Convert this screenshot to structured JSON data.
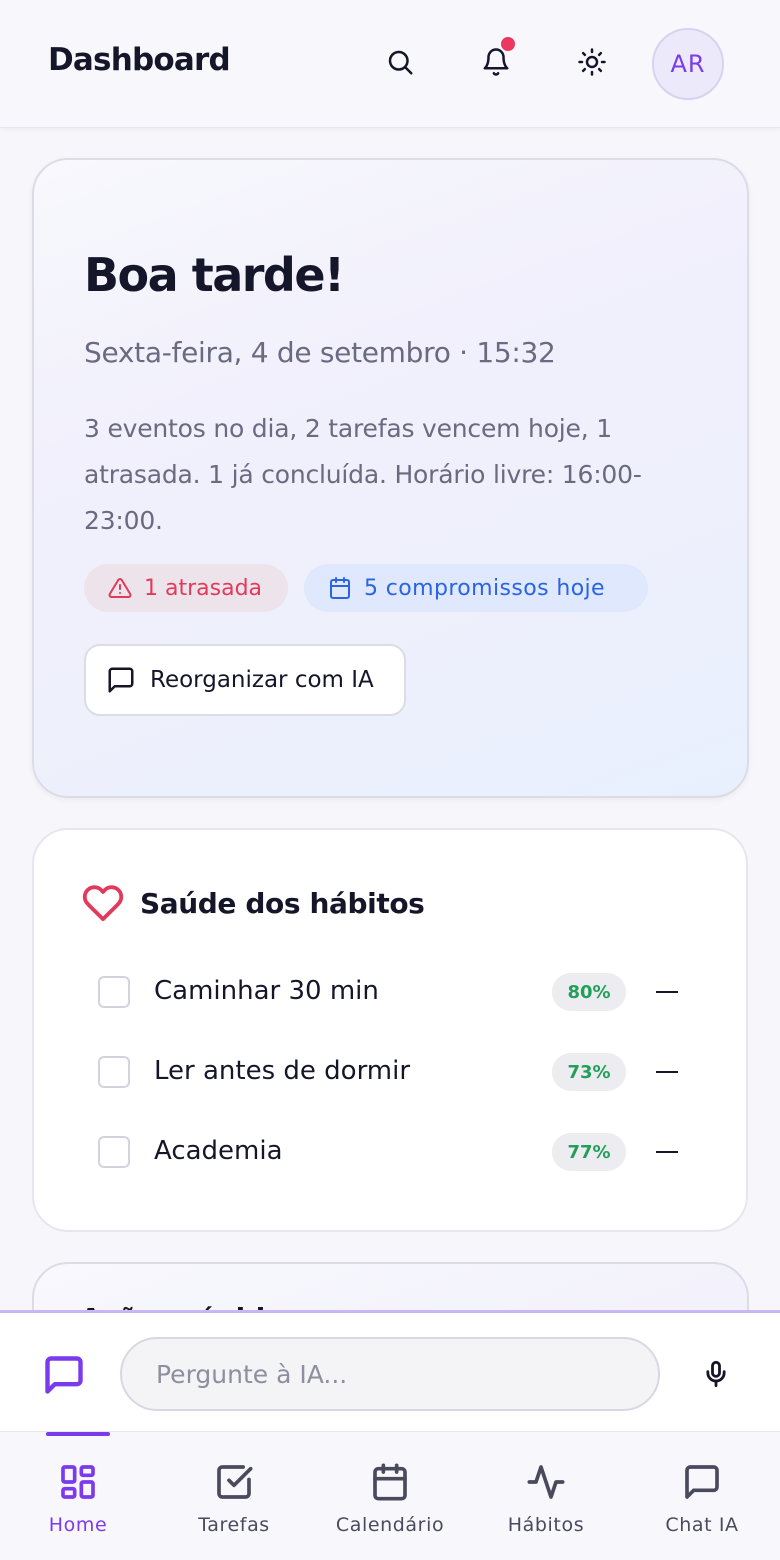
{
  "header": {
    "title": "Dashboard",
    "avatar_initials": "AR",
    "icons": [
      "search-icon",
      "bell-icon",
      "sun-icon"
    ]
  },
  "greeting": {
    "title": "Boa tarde!",
    "date": "Sexta-feira, 4 de setembro · 15:32",
    "summary": "3 eventos no dia, 2 tarefas vencem hoje, 1 atrasada. 1 já concluída. Horário livre: 16:00-23:00.",
    "chips": {
      "overdue": "1 atrasada",
      "appointments": "5 compromissos hoje"
    },
    "ai_button": "Reorganizar com IA"
  },
  "habits": {
    "title": "Saúde dos hábitos",
    "items": [
      {
        "name": "Caminhar 30 min",
        "percent": "80%"
      },
      {
        "name": "Ler antes de dormir",
        "percent": "73%"
      },
      {
        "name": "Academia",
        "percent": "77%"
      }
    ]
  },
  "partial_card": {
    "title": "Ações rápidas"
  },
  "chat": {
    "placeholder": "Pergunte à IA..."
  },
  "nav": {
    "items": [
      {
        "label": "Home",
        "icon": "grid-icon",
        "active": true
      },
      {
        "label": "Tarefas",
        "icon": "checkbox-icon",
        "active": false
      },
      {
        "label": "Calendário",
        "icon": "calendar-icon",
        "active": false
      },
      {
        "label": "Hábitos",
        "icon": "activity-icon",
        "active": false
      },
      {
        "label": "Chat IA",
        "icon": "chat-icon",
        "active": false
      }
    ]
  },
  "colors": {
    "accent": "#7c3aed",
    "danger": "#e23a5d",
    "info": "#2a63e4",
    "success": "#22a05a"
  }
}
